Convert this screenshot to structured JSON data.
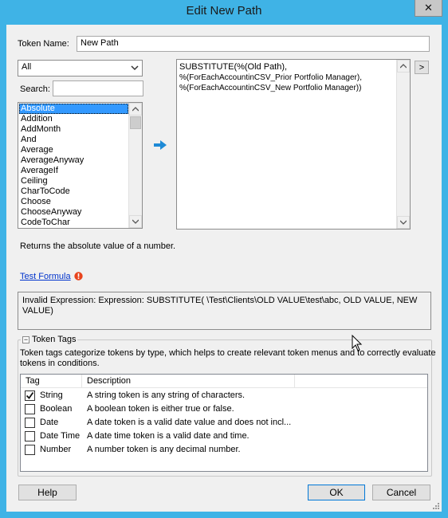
{
  "window": {
    "title": "Edit New Path",
    "close_glyph": "✕"
  },
  "token_name": {
    "label": "Token Name:",
    "value": "New Path"
  },
  "category_filter": {
    "selected": "All"
  },
  "search": {
    "label": "Search:",
    "value": ""
  },
  "functions": {
    "items": [
      "Absolute",
      "Addition",
      "AddMonth",
      "And",
      "Average",
      "AverageAnyway",
      "AverageIf",
      "Ceiling",
      "CharToCode",
      "Choose",
      "ChooseAnyway",
      "CodeToChar"
    ],
    "selected_index": 0
  },
  "insert_arrow": {
    "icon": "arrow-right-icon",
    "color": "#1e8ad6"
  },
  "formula": {
    "lines": [
      "SUBSTITUTE(%(Old Path),",
      "%(ForEachAccountinCSV_Prior Portfolio Manager),",
      "%(ForEachAccountinCSV_New Portfolio Manager))"
    ]
  },
  "expand_button": {
    "label": ">"
  },
  "function_description": "Returns the absolute value of a number.",
  "test_formula": {
    "label": "Test Formula",
    "error_icon": "error-icon",
    "error_color": "#e8431c"
  },
  "result": {
    "line1": "Invalid Expression:  Expression: SUBSTITUTE( \\Test\\Clients\\OLD VALUE\\test\\abc, OLD VALUE, NEW",
    "line2": "VALUE)"
  },
  "token_tags": {
    "collapse_glyph": "−",
    "title": "Token Tags",
    "help_line1": "Token tags categorize tokens by type, which helps to create relevant token menus and to correctly evaluate",
    "help_line2": "tokens in conditions.",
    "columns": {
      "tag": "Tag",
      "description": "Description"
    },
    "rows": [
      {
        "tag": "String",
        "description": "A string token is any string of characters.",
        "checked": true
      },
      {
        "tag": "Boolean",
        "description": "A boolean token is either true or false.",
        "checked": false
      },
      {
        "tag": "Date",
        "description": "A date token is a valid date value and does not incl...",
        "checked": false
      },
      {
        "tag": "Date Time",
        "description": "A date time token is a valid date and time.",
        "checked": false
      },
      {
        "tag": "Number",
        "description": "A number token is any decimal number.",
        "checked": false
      }
    ]
  },
  "buttons": {
    "help": "Help",
    "ok": "OK",
    "cancel": "Cancel"
  },
  "colors": {
    "titlebar": "#3fb3e6",
    "dialog_bg": "#f0f0f0",
    "selection": "#3399ff",
    "link": "#0033cc"
  }
}
